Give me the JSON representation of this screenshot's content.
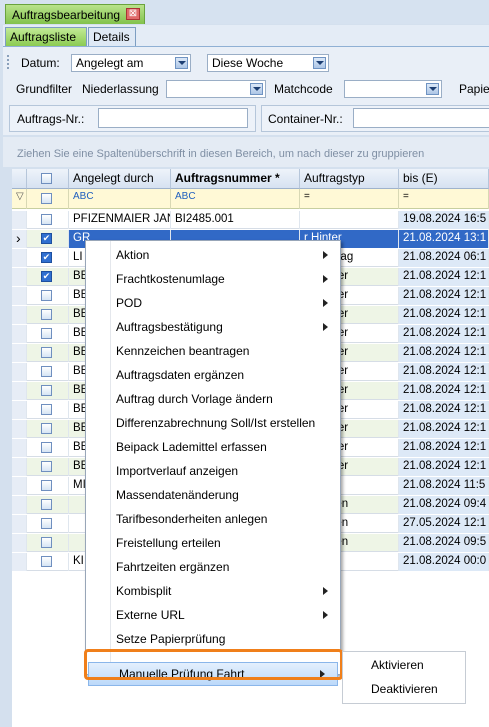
{
  "window_tab": {
    "title": "Auftragsbearbeitung",
    "close_glyph": "⊠"
  },
  "subtabs": [
    "Auftragsliste",
    "Details"
  ],
  "filter": {
    "datum_label": "Datum:",
    "datum_mode": "Angelegt am",
    "datum_period": "Diese Woche",
    "grundfilter_label": "Grundfilter",
    "niederlassung_label": "Niederlassung",
    "matchcode_label": "Matchcode",
    "papier_label": "Papie",
    "auftragsnr_label": "Auftrags-Nr.:",
    "containernr_label": "Container-Nr.:"
  },
  "group_hint": "Ziehen Sie eine Spaltenüberschrift in diesen Bereich, um nach dieser zu gruppieren",
  "grid": {
    "columns": [
      "Angelegt durch",
      "Auftragsnummer *",
      "Auftragstyp",
      "bis (E)"
    ],
    "filter_cells": [
      "ABC",
      "ABC",
      "=",
      "="
    ],
    "rows": [
      {
        "checked": false,
        "angelegt": "PFIZENMAIER JAN",
        "nr": "BI2485.001",
        "typ": "",
        "bis": "19.08.2024 16:5"
      },
      {
        "checked": true,
        "angelegt": "GR",
        "nr": "",
        "typ": "r Hinter",
        "bis": "21.08.2024 13:1"
      },
      {
        "checked": true,
        "angelegt": "LI",
        "nr": "",
        "typ": "ortauftrag",
        "bis": "21.08.2024 06:1"
      },
      {
        "checked": true,
        "angelegt": "BE",
        "nr": "",
        "typ": "er Hinter",
        "bis": "21.08.2024 12:1"
      },
      {
        "checked": false,
        "angelegt": "BE",
        "nr": "",
        "typ": "er Hinter",
        "bis": "21.08.2024 12:1"
      },
      {
        "checked": false,
        "angelegt": "BE",
        "nr": "",
        "typ": "er Hinter",
        "bis": "21.08.2024 12:1"
      },
      {
        "checked": false,
        "angelegt": "BE",
        "nr": "",
        "typ": "er Hinter",
        "bis": "21.08.2024 12:1"
      },
      {
        "checked": false,
        "angelegt": "BE",
        "nr": "",
        "typ": "er Hinter",
        "bis": "21.08.2024 12:1"
      },
      {
        "checked": false,
        "angelegt": "BE",
        "nr": "",
        "typ": "er Hinter",
        "bis": "21.08.2024 12:1"
      },
      {
        "checked": false,
        "angelegt": "BE",
        "nr": "",
        "typ": "er Hinter",
        "bis": "21.08.2024 12:1"
      },
      {
        "checked": false,
        "angelegt": "BE",
        "nr": "",
        "typ": "er Hinter",
        "bis": "21.08.2024 12:1"
      },
      {
        "checked": false,
        "angelegt": "BE",
        "nr": "",
        "typ": "er Hinter",
        "bis": "21.08.2024 12:1"
      },
      {
        "checked": false,
        "angelegt": "BE",
        "nr": "",
        "typ": "er Hinter",
        "bis": "21.08.2024 12:1"
      },
      {
        "checked": false,
        "angelegt": "BE",
        "nr": "",
        "typ": "er Hinter",
        "bis": "21.08.2024 12:1"
      },
      {
        "checked": false,
        "angelegt": "MI",
        "nr": "",
        "typ": "",
        "bis": "21.08.2024 11:5"
      },
      {
        "checked": false,
        "angelegt": "",
        "nr": "",
        "typ": "er Hafen",
        "bis": "21.08.2024 09:4"
      },
      {
        "checked": false,
        "angelegt": "",
        "nr": "",
        "typ": "er Hafen",
        "bis": "27.05.2024 12:1"
      },
      {
        "checked": false,
        "angelegt": "",
        "nr": "",
        "typ": "er Hafen",
        "bis": "21.08.2024 09:5"
      },
      {
        "checked": false,
        "angelegt": "KI",
        "nr": "",
        "typ": "",
        "bis": "21.08.2024 00:0"
      }
    ]
  },
  "context_menu": {
    "items": [
      {
        "label": "Aktion",
        "submenu": true
      },
      {
        "label": "Frachtkostenumlage",
        "submenu": true
      },
      {
        "label": "POD",
        "submenu": true
      },
      {
        "label": "Auftragsbestätigung",
        "submenu": true
      },
      {
        "label": "Kennzeichen beantragen",
        "submenu": false
      },
      {
        "label": "Auftragsdaten ergänzen",
        "submenu": false
      },
      {
        "label": "Auftrag durch Vorlage ändern",
        "submenu": false
      },
      {
        "label": "Differenzabrechnung Soll/Ist erstellen",
        "submenu": false
      },
      {
        "label": "Beipack Lademittel erfassen",
        "submenu": false
      },
      {
        "label": "Importverlauf anzeigen",
        "submenu": false
      },
      {
        "label": "Massendatenänderung",
        "submenu": false
      },
      {
        "label": "Tarifbesonderheiten anlegen",
        "submenu": false
      },
      {
        "label": "Freistellung erteilen",
        "submenu": false
      },
      {
        "label": "Fahrtzeiten ergänzen",
        "submenu": false
      },
      {
        "label": "Kombisplit",
        "submenu": true
      },
      {
        "label": "Externe URL",
        "submenu": true
      },
      {
        "label": "Setze Papierprüfung",
        "submenu": false
      },
      {
        "label": "Manuelle Prüfung Fahrt",
        "submenu": true
      }
    ],
    "highlighted": "Manuelle Prüfung Fahrt"
  },
  "submenu": {
    "items": [
      "Aktivieren",
      "Deaktivieren"
    ]
  }
}
